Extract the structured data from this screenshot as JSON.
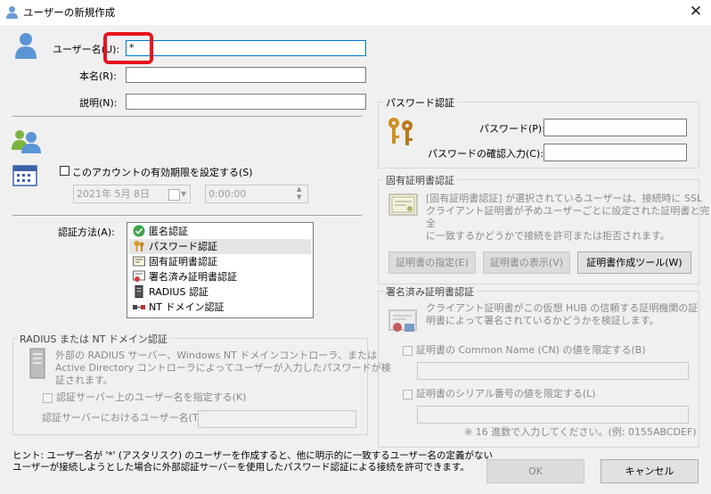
{
  "window": {
    "title": "ユーザーの新規作成"
  },
  "form": {
    "username": {
      "label": "ユーザー名(U):",
      "value": "*"
    },
    "realname": {
      "label": "本名(R):",
      "value": ""
    },
    "note": {
      "label": "説明(N):",
      "value": ""
    },
    "expire": {
      "label": "このアカウントの有効期限を設定する(S)",
      "date": "2021年  5月  8日",
      "time": "0:00:00"
    },
    "auth_method_label": "認証方法(A):",
    "auth_methods": [
      {
        "label": "匿名認証",
        "icon": "check-circle-icon"
      },
      {
        "label": "パスワード認証",
        "icon": "keys-icon"
      },
      {
        "label": "固有証明書認証",
        "icon": "certificate-icon"
      },
      {
        "label": "署名済み証明書認証",
        "icon": "signed-certificate-icon"
      },
      {
        "label": "RADIUS 認証",
        "icon": "server-icon"
      },
      {
        "label": "NT ドメイン認証",
        "icon": "nt-domain-icon"
      }
    ],
    "selected_auth": "パスワード認証"
  },
  "radius": {
    "title": "RADIUS または NT ドメイン認証",
    "desc_lines": [
      "外部の RADIUS サーバー、Windows NT ドメインコントローラ、または",
      "Active Directory コントローラによってユーザーが入力したパスワードが検",
      "証されます。"
    ],
    "specify_check": "認証サーバー上のユーザー名を指定する(K)",
    "server_username_label": "認証サーバーにおけるユーザー名(T):"
  },
  "password_auth": {
    "title": "パスワード認証",
    "password_label": "パスワード(P):",
    "confirm_label": "パスワードの確認入力(C):"
  },
  "cert_auth": {
    "title": "固有証明書認証",
    "desc_lines": [
      "[固有証明書認証] が選択されているユーザーは、接続時に SSL",
      "クライアント証明書が予めユーザーごとに設定された証明書と完全",
      "に一致するかどうかで接続を許可または拒否されます。"
    ],
    "specify_btn": "証明書の指定(E)",
    "view_btn": "証明書の表示(V)",
    "tool_btn": "証明書作成ツール(W)"
  },
  "signed_auth": {
    "title": "署名済み証明書認証",
    "desc_lines": [
      "クライアント証明書がこの仮想 HUB の信頼する証明機関の証",
      "明書によって署名されているかどうかを検証します。"
    ],
    "cn_check": "証明書の Common Name (CN) の値を限定する(B)",
    "serial_check": "証明書のシリアル番号の値を限定する(L)",
    "serial_note": "※ 16 進数で入力してください。(例: 0155ABCDEF)"
  },
  "hint_lines": [
    "ヒント: ユーザー名が '*' (アスタリスク) のユーザーを作成すると、他に明示的に一致するユーザー名の定義がない",
    "ユーザーが接続しようとした場合に外部認証サーバーを使用したパスワード認証による接続を許可できます。"
  ],
  "buttons": {
    "ok": "OK",
    "cancel": "キャンセル"
  },
  "colors": {
    "accent": "#0078d7",
    "highlight": "#e8141c"
  }
}
